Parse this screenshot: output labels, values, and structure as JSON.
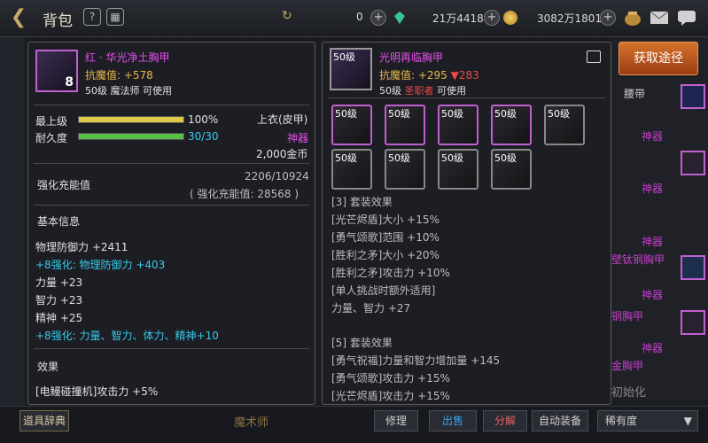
{
  "topbar": {
    "title": "背包",
    "currencies": [
      {
        "value": "0"
      },
      {
        "value": "21万4418"
      },
      {
        "value": "3082万1801"
      }
    ]
  },
  "left_item": {
    "badge": "8",
    "name": "红 · 华光净土胸甲",
    "stat": "抗魔值: +578",
    "req": "50级 魔法师 可使用",
    "level_label": "最上级",
    "level_pct": "100%",
    "level_fill": 1.0,
    "durability_label": "耐久度",
    "durability_val": "30/30",
    "durability_fill": 1.0,
    "slot": "上衣(皮甲)",
    "rarity": "神器",
    "price": "2,000金币",
    "charge_label": "强化充能值",
    "charge_val": "2206/10924",
    "charge_sub": "( 强化充能值: 28568 )",
    "basic_title": "基本信息",
    "basic_lines": [
      {
        "text": "物理防御力 +2411",
        "color": "white"
      },
      {
        "text": "+8强化: 物理防御力 +403",
        "color": "cyan"
      },
      {
        "text": "力量 +23",
        "color": "white"
      },
      {
        "text": "智力 +23",
        "color": "white"
      },
      {
        "text": "精神 +25",
        "color": "white"
      },
      {
        "text": "+8强化: 力量、智力、体力、精神+10",
        "color": "cyan"
      }
    ],
    "effect_title": "效果",
    "effect_line": "[电鳗碰撞机]攻击力 +5%"
  },
  "right_item": {
    "thumb_level": "50级",
    "name": "光明再临胸甲",
    "stat_prefix": "抗魔值: +295",
    "stat_diff": "▼283",
    "req_level": "50级",
    "req_class": "圣职者",
    "req_suffix": "可使用",
    "set_slots": [
      "50级",
      "50级",
      "50级",
      "50级",
      "50级",
      "50级",
      "50级",
      "50级",
      "50级"
    ],
    "set3_title": "[3] 套装效果",
    "set3_lines": [
      "[光芒烬盾]大小 +15%",
      "[勇气颂歌]范围 +10%",
      "[胜利之矛]大小 +20%",
      "[胜利之矛]攻击力 +10%",
      "[单人挑战时额外适用]",
      "力量、智力 +27"
    ],
    "set5_title": "[5] 套装效果",
    "set5_lines": [
      "[勇气祝福]力量和智力增加量 +145",
      "[勇气颂歌]攻击力 +15%",
      "[光芒烬盾]攻击力 +15%"
    ]
  },
  "sidebar": {
    "get_button": "获取途径",
    "tab_belt": "腰带",
    "labels": [
      "神器",
      "神器",
      "神器",
      "神器",
      "神器",
      "神器",
      "神器"
    ],
    "item_fragments": [
      "壁钛钢胸甲",
      "钢胸甲",
      "金胸甲"
    ],
    "init_fragment": "初始化"
  },
  "bottom": {
    "left_tab": "道具辞典",
    "class_label": "魔术师",
    "repair": "修理",
    "sell": "出售",
    "decompose": "分解",
    "auto_equip": "自动装备",
    "sort": "稀有度"
  }
}
